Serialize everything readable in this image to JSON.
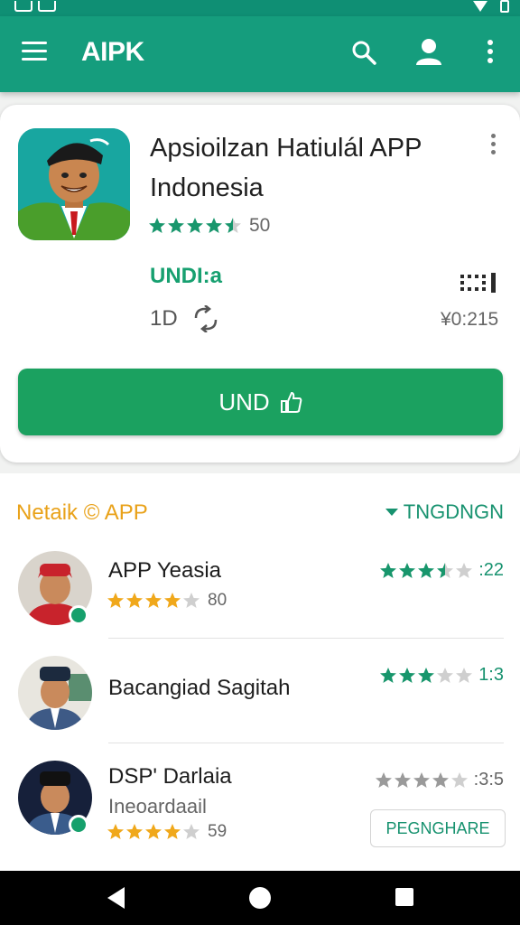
{
  "app_title": "AIPK",
  "featured": {
    "name_line1": "Apsioilzan Hatiulál APP",
    "name_line2": "Indonesia",
    "rating": 4.5,
    "rating_text": "50",
    "publisher": "UNDI:a",
    "size_text": "1D",
    "code_text": "¥0:215",
    "install_label": "UND",
    "accent_color": "#1ba160"
  },
  "section": {
    "title": "Netaik © APP",
    "sort_label": "TNGDNGN"
  },
  "apps": [
    {
      "name": "APP Yeasia",
      "rating": 4,
      "rating_text": "80",
      "right_rating": 3.5,
      "right_text": ":22"
    },
    {
      "name": "Bacangiad Sagitah",
      "right_rating": 3,
      "right_text": "1:3"
    },
    {
      "name": "DSP' Darlaia",
      "subtitle": "Ineoardaail",
      "rating": 4,
      "rating_text": "59",
      "right_rating": 4,
      "right_text": ":3:5",
      "action_label": "PEGNGHARE"
    }
  ],
  "icons": [
    "menu-icon",
    "search-icon",
    "account-icon",
    "more-vert-icon",
    "thumb-up-icon",
    "sync-icon",
    "back-icon",
    "home-icon",
    "recents-icon"
  ]
}
